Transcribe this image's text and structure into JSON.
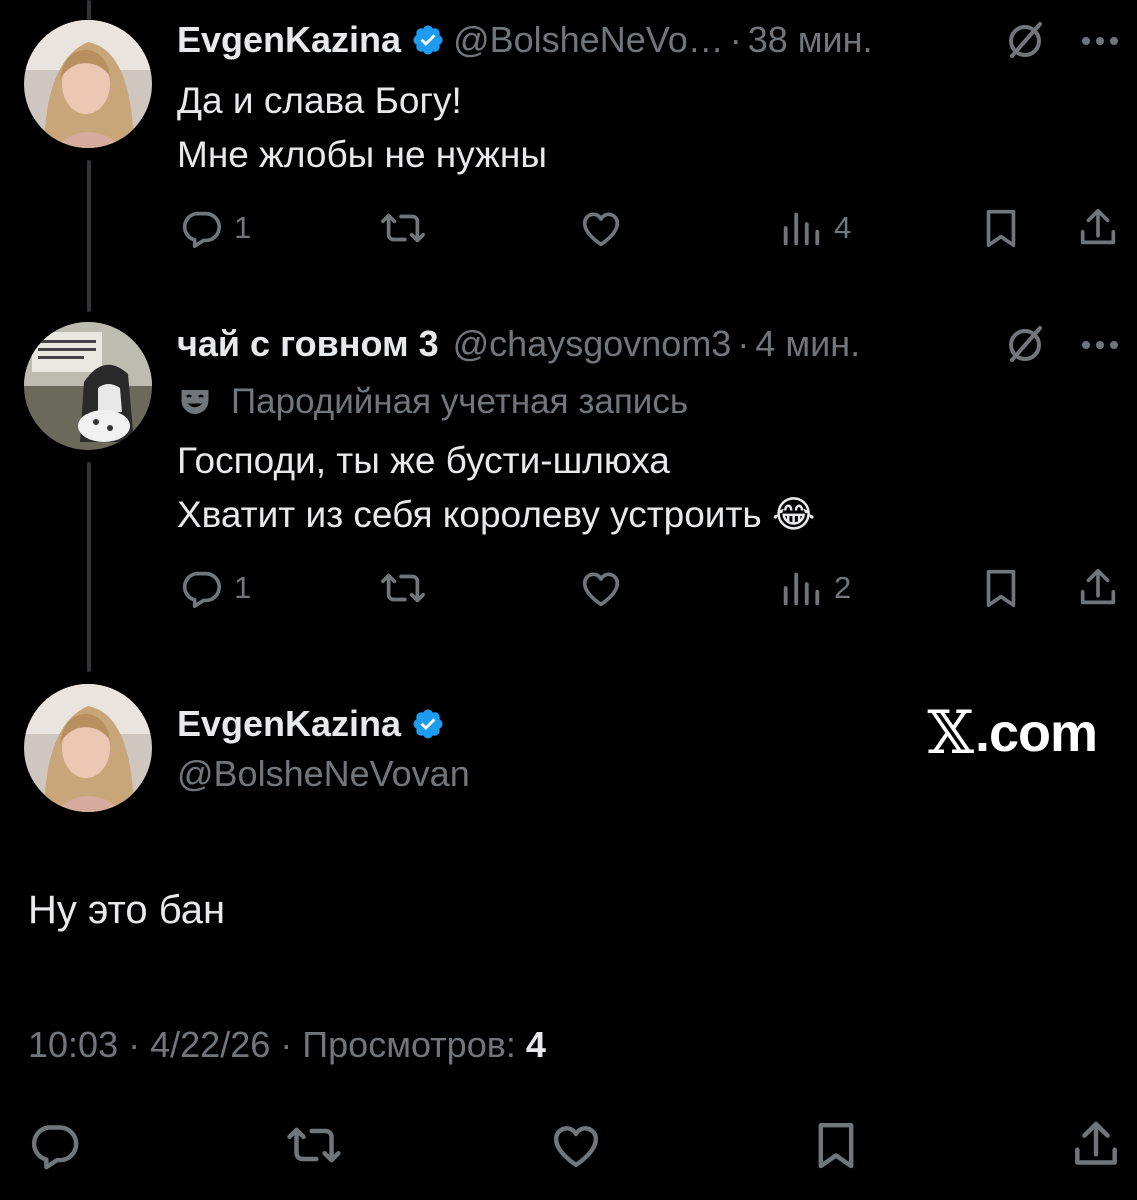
{
  "tweet1": {
    "display_name": "EvgenKazina",
    "handle": "@BolsheNeVo…",
    "sep": "·",
    "time": "38 мин.",
    "line1": "Да и слава Богу!",
    "line2": "Мне жлобы не нужны",
    "replies": "1",
    "views": "4"
  },
  "tweet2": {
    "display_name": "чай с говном 3",
    "handle": "@chaysgovnom3",
    "sep": "·",
    "time": "4 мин.",
    "parody_label": "Пародийная учетная запись",
    "line1": "Господи, ты же бусти-шлюха",
    "line2": "Хватит из себя королеву устроить 😂",
    "replies": "1",
    "views": "2"
  },
  "main_tweet": {
    "display_name": "EvgenKazina",
    "handle": "@BolsheNeVovan",
    "text": "Ну это бан",
    "time": "10:03",
    "date": "4/22/26",
    "sep": "·",
    "views_label": "Просмотров:",
    "views": "4"
  },
  "watermark": {
    "mark": "𝕏",
    "text": ".com"
  },
  "icons": [
    "verified-badge-icon",
    "grok-icon",
    "more-icon",
    "reply-icon",
    "retweet-icon",
    "like-icon",
    "views-icon",
    "bookmark-icon",
    "share-icon",
    "parody-mask-icon"
  ],
  "colors": {
    "background": "#000000",
    "text": "#e7e9ea",
    "muted": "#71767b",
    "verified": "#1d9bf0"
  }
}
